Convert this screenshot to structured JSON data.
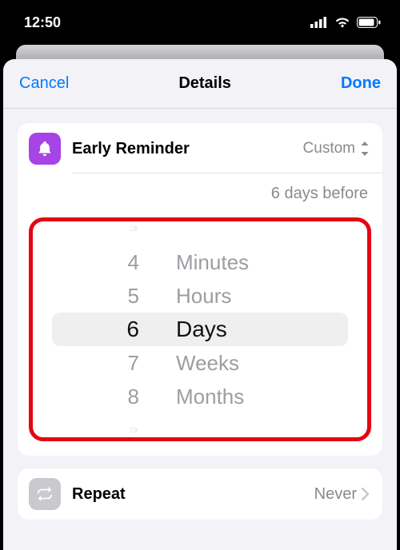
{
  "status": {
    "time": "12:50"
  },
  "nav": {
    "cancel": "Cancel",
    "title": "Details",
    "done": "Done"
  },
  "early_reminder": {
    "title": "Early Reminder",
    "mode_label": "Custom",
    "summary": "6 days before",
    "picker": {
      "numbers": {
        "n0": "3",
        "n1": "4",
        "n2": "5",
        "sel": "6",
        "n4": "7",
        "n5": "8",
        "n6": "9"
      },
      "units": {
        "u0": "Minutes",
        "u1": "Hours",
        "sel": "Days",
        "u3": "Weeks",
        "u4": "Months"
      }
    }
  },
  "repeat": {
    "title": "Repeat",
    "value": "Never"
  }
}
